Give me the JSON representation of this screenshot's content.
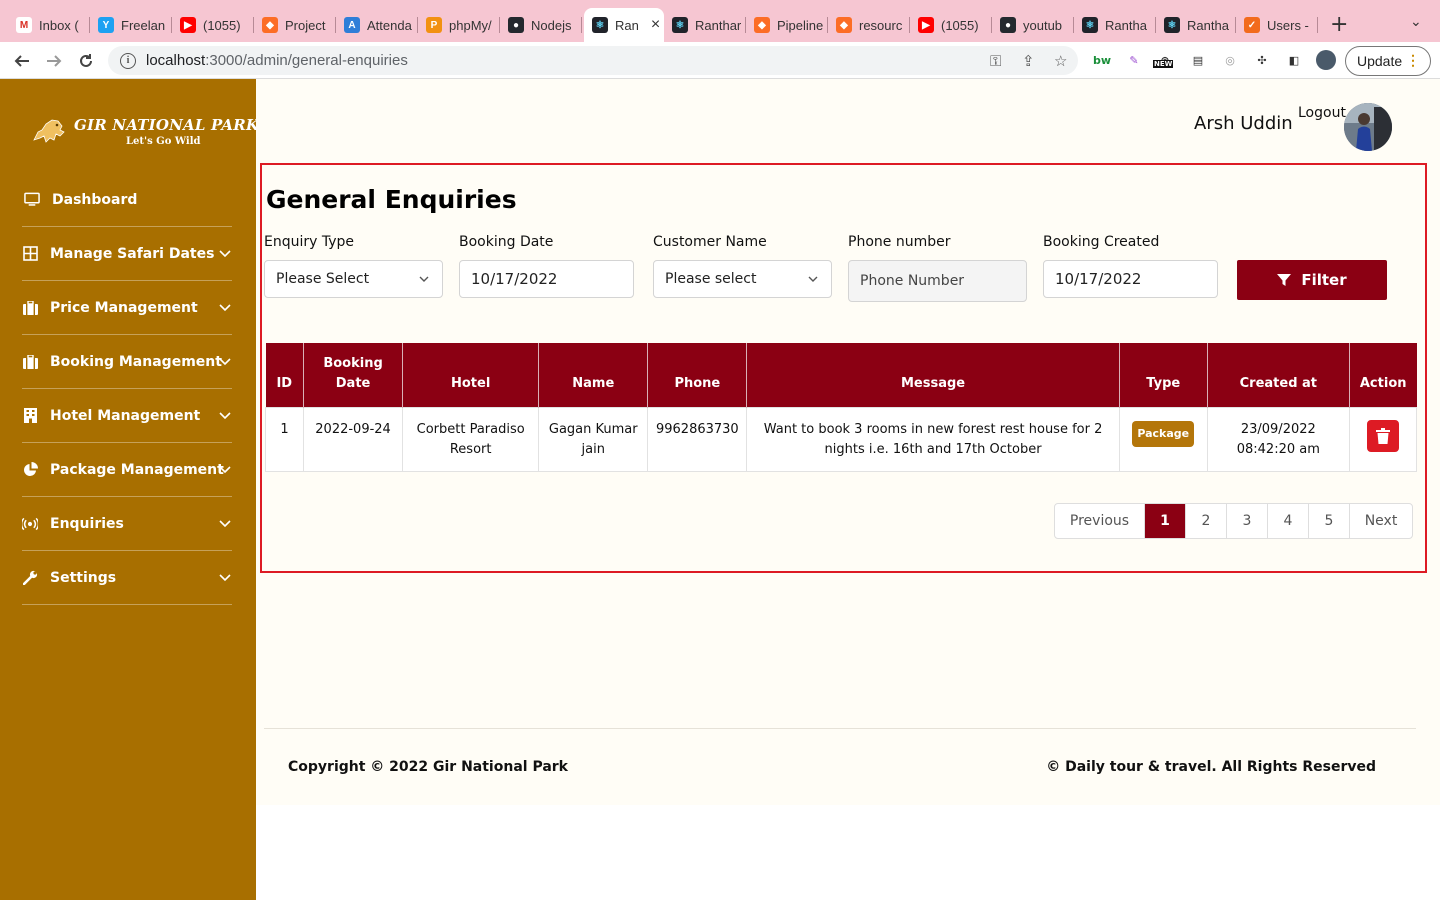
{
  "browser": {
    "tabs": [
      {
        "label": "Inbox (",
        "color": "#ffffff",
        "glyph": "M"
      },
      {
        "label": "Freelan",
        "color": "#1da1f2",
        "glyph": "Y"
      },
      {
        "label": "(1055) ",
        "color": "#ff0000",
        "glyph": "▶"
      },
      {
        "label": "Project",
        "color": "#fc6d26",
        "glyph": "◆"
      },
      {
        "label": "Attenda",
        "color": "#2f7ed8",
        "glyph": "A"
      },
      {
        "label": "phpMy/",
        "color": "#f29111",
        "glyph": "P"
      },
      {
        "label": "Nodejs",
        "color": "#24292f",
        "glyph": "●"
      },
      {
        "label": "Ran",
        "color": "#20232a",
        "glyph": "⚛"
      },
      {
        "label": "Ranthar",
        "color": "#20232a",
        "glyph": "⚛"
      },
      {
        "label": "Pipeline",
        "color": "#fc6d26",
        "glyph": "◆"
      },
      {
        "label": "resourc",
        "color": "#fc6d26",
        "glyph": "◆"
      },
      {
        "label": "(1055) ",
        "color": "#ff0000",
        "glyph": "▶"
      },
      {
        "label": "youtub",
        "color": "#24292f",
        "glyph": "●"
      },
      {
        "label": "Rantha",
        "color": "#20232a",
        "glyph": "⚛"
      },
      {
        "label": "Rantha",
        "color": "#20232a",
        "glyph": "⚛"
      },
      {
        "label": "Users -",
        "color": "#f26b1d",
        "glyph": "✓"
      }
    ],
    "url_host": "localhost",
    "url_path": ":3000/admin/general-enquiries",
    "update_label": "Update",
    "ext_new_badge": "NEW"
  },
  "brand": {
    "title": "GIR NATIONAL PARK",
    "tagline": "Let's Go Wild",
    "sidebar_color": "#a86f00",
    "accent": "#8b0013",
    "panel_border": "#dd1b24"
  },
  "sidebar": {
    "items": [
      {
        "label": "Dashboard",
        "icon": "monitor-icon",
        "has_chevron": false
      },
      {
        "label": "Manage Safari Dates",
        "icon": "grid-icon",
        "has_chevron": true
      },
      {
        "label": "Price Management",
        "icon": "briefcase-icon",
        "has_chevron": true
      },
      {
        "label": "Booking Management",
        "icon": "briefcase-icon",
        "has_chevron": true
      },
      {
        "label": "Hotel Management",
        "icon": "building-icon",
        "has_chevron": true
      },
      {
        "label": "Package Management",
        "icon": "pie-chart-icon",
        "has_chevron": true
      },
      {
        "label": "Enquiries",
        "icon": "broadcast-icon",
        "has_chevron": true
      },
      {
        "label": "Settings",
        "icon": "wrench-icon",
        "has_chevron": true
      }
    ]
  },
  "header": {
    "user_name": "Arsh Uddin",
    "logout_label": "Logout"
  },
  "page": {
    "title": "General Enquiries"
  },
  "filters": {
    "enquiry_type": {
      "label": "Enquiry Type",
      "value": "Please Select"
    },
    "booking_date": {
      "label": "Booking Date",
      "value": "10/17/2022"
    },
    "customer_name": {
      "label": "Customer Name",
      "value": "Please select"
    },
    "phone_number": {
      "label": "Phone number",
      "placeholder": "Phone Number"
    },
    "booking_created": {
      "label": "Booking Created",
      "value": "10/17/2022"
    },
    "filter_button": "Filter"
  },
  "table": {
    "headers": [
      "ID",
      "Booking Date",
      "Hotel",
      "Name",
      "Phone",
      "Message",
      "Type",
      "Created at",
      "Action"
    ],
    "rows": [
      {
        "id": "1",
        "booking_date": "2022-09-24",
        "hotel": "Corbett Paradiso Resort",
        "name": "Gagan Kumar jain",
        "phone": "9962863730",
        "message": "Want to book 3 rooms in new forest rest house for 2 nights i.e. 16th and 17th October",
        "type": "Package",
        "created_date": "23/09/2022",
        "created_time": "08:42:20 am",
        "action_icon": "trash-icon"
      }
    ]
  },
  "pagination": {
    "previous": "Previous",
    "pages": [
      "1",
      "2",
      "3",
      "4",
      "5"
    ],
    "current": "1",
    "next": "Next"
  },
  "footer": {
    "left": "Copyright © 2022 Gir National Park",
    "right": "© Daily tour & travel. All Rights Reserved"
  }
}
